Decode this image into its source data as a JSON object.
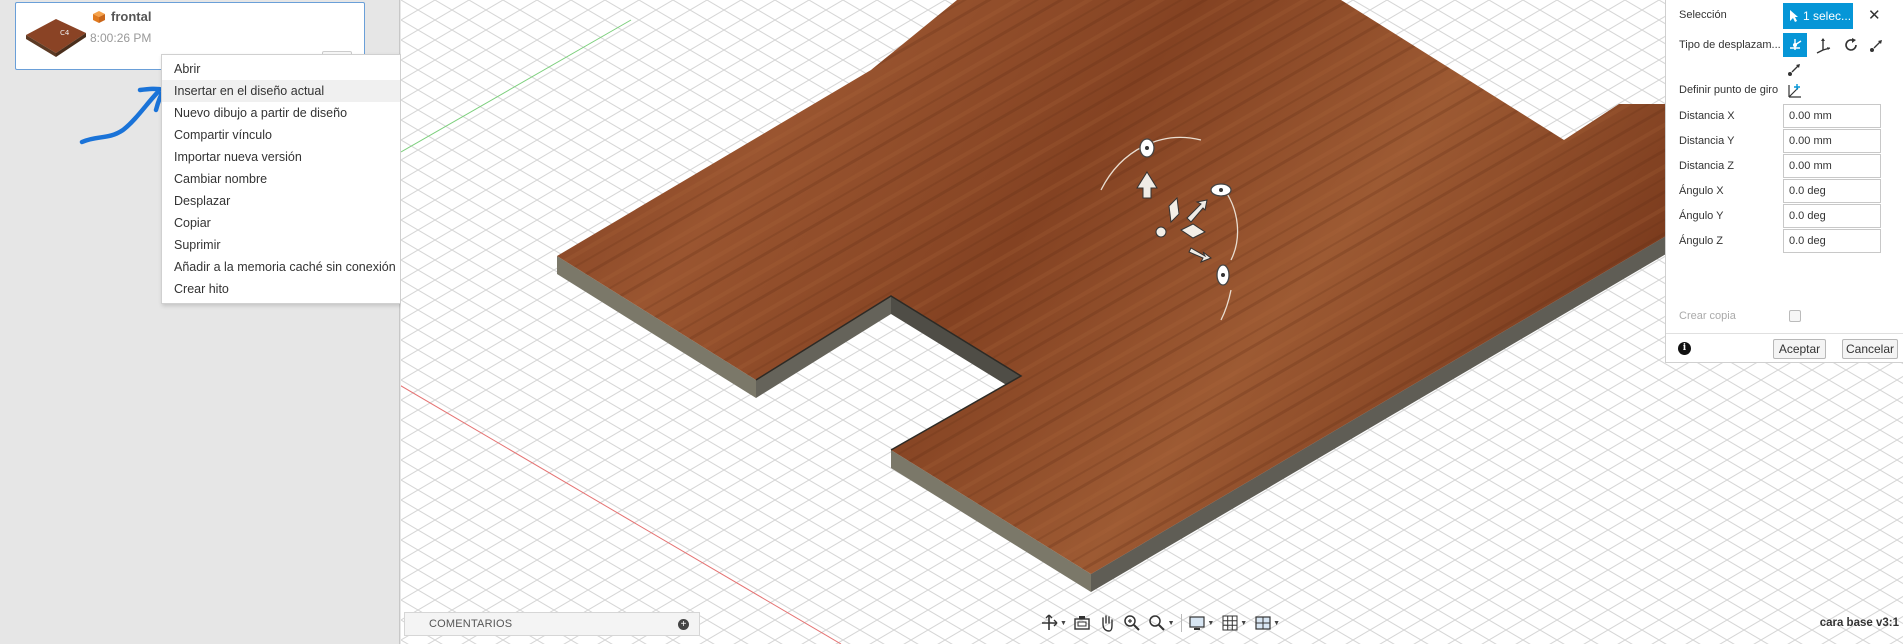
{
  "file_card": {
    "name": "frontal",
    "time": "8:00:26 PM"
  },
  "context_menu": {
    "items": [
      "Abrir",
      "Insertar en el diseño actual",
      "Nuevo dibujo a partir de diseño",
      "Compartir vínculo",
      "Importar nueva versión",
      "Cambiar nombre",
      "Desplazar",
      "Copiar",
      "Suprimir",
      "Añadir a la memoria caché sin conexión",
      "Crear hito"
    ],
    "highlighted_index": 1
  },
  "comments": {
    "label": "COMENTARIOS",
    "add_icon": "plus-circle-icon"
  },
  "nav_toolbar": {
    "icons": [
      "orbit-icon",
      "look-at-icon",
      "pan-hand-icon",
      "zoom-icon",
      "fit-zoom-icon",
      "display-mode-icon",
      "grid-icon",
      "viewports-icon"
    ]
  },
  "version_label": "cara base v3:1",
  "move_panel": {
    "selection_label": "Selección",
    "selection_value": "1 selec...",
    "move_type_label": "Tipo de desplazam...",
    "pivot_label": "Definir punto de giro",
    "fields": [
      {
        "label": "Distancia X",
        "value": "0.00 mm"
      },
      {
        "label": "Distancia Y",
        "value": "0.00 mm"
      },
      {
        "label": "Distancia Z",
        "value": "0.00 mm"
      },
      {
        "label": "Ángulo X",
        "value": "0.0 deg"
      },
      {
        "label": "Ángulo Y",
        "value": "0.0 deg"
      },
      {
        "label": "Ángulo Z",
        "value": "0.0 deg"
      }
    ],
    "copy_label": "Crear copia",
    "copy_checked": false,
    "ok_label": "Aceptar",
    "cancel_label": "Cancelar",
    "accent_color": "#0696d7"
  },
  "colors": {
    "wood_top": "#8a4325",
    "wood_side": "#6e6b62",
    "grid": "#d4d4d4",
    "annotation": "#1a73d8"
  }
}
